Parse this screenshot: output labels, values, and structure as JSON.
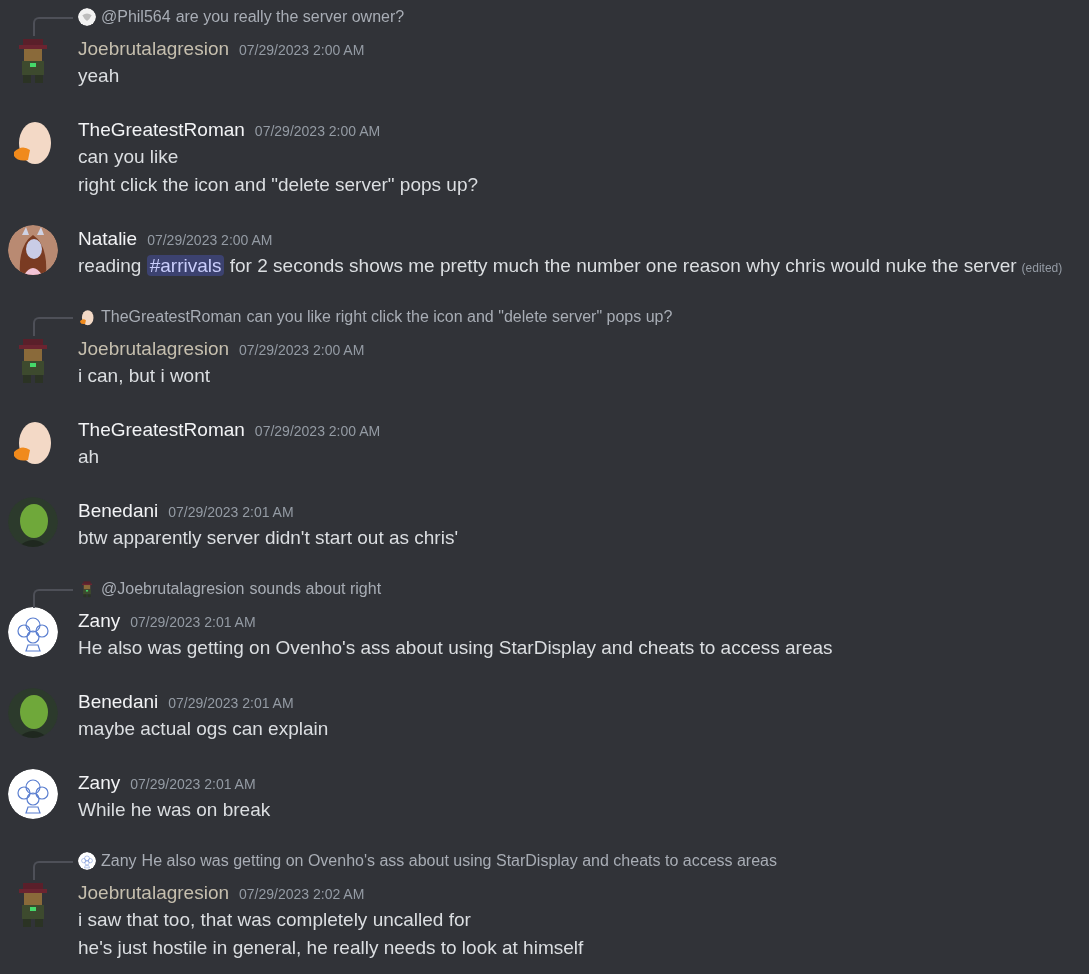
{
  "messages": [
    {
      "reply": {
        "avatar": {
          "kind": "sketch-face"
        },
        "author": "@Phil564",
        "text": "are you really the server owner?"
      },
      "avatar": {
        "kind": "sprite"
      },
      "author": "Joebrutalagresion",
      "color": "#c6bfae",
      "timestamp": "07/29/2023 2:00 AM",
      "lines": [
        [
          {
            "kind": "text",
            "text": "yeah"
          }
        ]
      ]
    },
    {
      "avatar": {
        "kind": "egg"
      },
      "author": "TheGreatestRoman",
      "color": "#f2f3f5",
      "timestamp": "07/29/2023 2:00 AM",
      "lines": [
        [
          {
            "kind": "text",
            "text": "can you like"
          }
        ],
        [
          {
            "kind": "text",
            "text": "right click the icon and \"delete server\" pops up?"
          }
        ]
      ]
    },
    {
      "avatar": {
        "kind": "portrait"
      },
      "author": "Natalie",
      "color": "#f2f3f5",
      "timestamp": "07/29/2023 2:00 AM",
      "lines": [
        [
          {
            "kind": "text",
            "text": "reading "
          },
          {
            "kind": "channel",
            "text": "#arrivals"
          },
          {
            "kind": "text",
            "text": " for 2 seconds shows me pretty much the number one reason why chris would nuke the server"
          },
          {
            "kind": "edited",
            "text": "(edited)"
          }
        ]
      ]
    },
    {
      "reply": {
        "avatar": {
          "kind": "egg"
        },
        "author": "TheGreatestRoman",
        "text": "can you like right click the icon and \"delete server\" pops up?"
      },
      "avatar": {
        "kind": "sprite"
      },
      "author": "Joebrutalagresion",
      "color": "#c6bfae",
      "timestamp": "07/29/2023 2:00 AM",
      "lines": [
        [
          {
            "kind": "text",
            "text": "i can, but i wont"
          }
        ]
      ]
    },
    {
      "avatar": {
        "kind": "egg"
      },
      "author": "TheGreatestRoman",
      "color": "#f2f3f5",
      "timestamp": "07/29/2023 2:00 AM",
      "lines": [
        [
          {
            "kind": "text",
            "text": "ah"
          }
        ]
      ]
    },
    {
      "avatar": {
        "kind": "green"
      },
      "author": "Benedani",
      "color": "#f2f3f5",
      "timestamp": "07/29/2023 2:01 AM",
      "lines": [
        [
          {
            "kind": "text",
            "text": "btw apparently server didn't start out as chris'"
          }
        ]
      ]
    },
    {
      "reply": {
        "avatar": {
          "kind": "sprite"
        },
        "author": "@Joebrutalagresion",
        "text": "sounds about right"
      },
      "avatar": {
        "kind": "sketch"
      },
      "author": "Zany",
      "color": "#f2f3f5",
      "timestamp": "07/29/2023 2:01 AM",
      "lines": [
        [
          {
            "kind": "text",
            "text": "He also was getting on Ovenho's ass about using StarDisplay and cheats to access areas"
          }
        ]
      ]
    },
    {
      "avatar": {
        "kind": "green"
      },
      "author": "Benedani",
      "color": "#f2f3f5",
      "timestamp": "07/29/2023 2:01 AM",
      "lines": [
        [
          {
            "kind": "text",
            "text": "maybe actual ogs can explain"
          }
        ]
      ]
    },
    {
      "avatar": {
        "kind": "sketch"
      },
      "author": "Zany",
      "color": "#f2f3f5",
      "timestamp": "07/29/2023 2:01 AM",
      "lines": [
        [
          {
            "kind": "text",
            "text": "While he was on break"
          }
        ]
      ]
    },
    {
      "reply": {
        "avatar": {
          "kind": "sketch"
        },
        "author": "Zany",
        "text": "He also was getting on Ovenho's ass about using StarDisplay and cheats to access areas"
      },
      "avatar": {
        "kind": "sprite"
      },
      "author": "Joebrutalagresion",
      "color": "#c6bfae",
      "timestamp": "07/29/2023 2:02 AM",
      "lines": [
        [
          {
            "kind": "text",
            "text": "i saw that too, that was completely uncalled for"
          }
        ],
        [
          {
            "kind": "text",
            "text": "he's just hostile in general, he really needs to look at himself"
          }
        ]
      ]
    }
  ]
}
